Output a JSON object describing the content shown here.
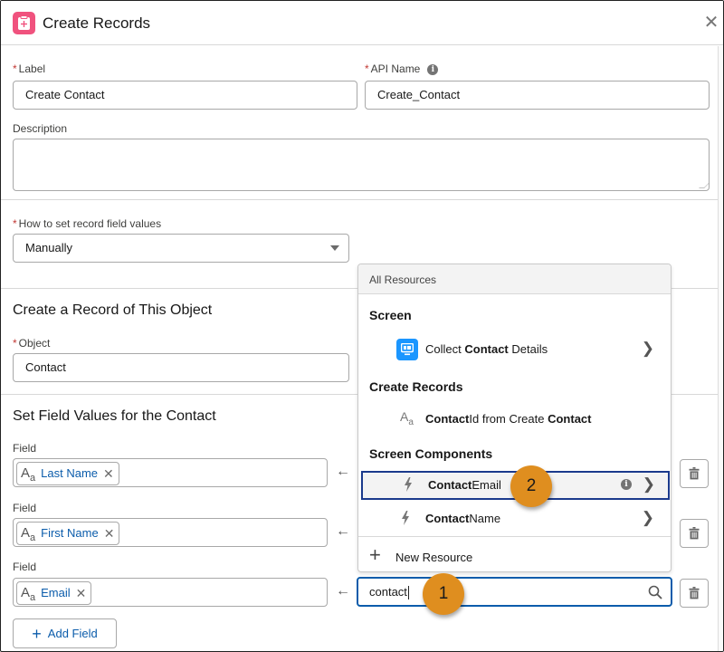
{
  "header": {
    "title": "Create Records",
    "icon": "create-record-icon",
    "icon_color": "#f0527e",
    "close_icon": "close-icon"
  },
  "general": {
    "label_field": {
      "label": "Label",
      "required": true,
      "value": "Create Contact"
    },
    "api_name_field": {
      "label": "API Name",
      "required": true,
      "value": "Create_Contact",
      "info_icon": "i"
    },
    "description_field": {
      "label": "Description",
      "value": ""
    }
  },
  "field_values_mode": {
    "label": "How to set record field values",
    "required": true,
    "selected": "Manually"
  },
  "object_section": {
    "title": "Create a Record of This Object",
    "object_field": {
      "label": "Object",
      "required": true,
      "value": "Contact"
    }
  },
  "field_values_section": {
    "title": "Set Field Values for the Contact",
    "rows": [
      {
        "field_label": "Field",
        "field_value": "Last Name",
        "type_icon": "text-type-icon"
      },
      {
        "field_label": "Field",
        "field_value": "First Name",
        "type_icon": "text-type-icon"
      },
      {
        "field_label": "Field",
        "field_value": "Email",
        "type_icon": "text-type-icon"
      }
    ],
    "arrow": "←",
    "add_field_label": "Add Field"
  },
  "resource_picker": {
    "header": "All Resources",
    "groups": [
      {
        "name": "Screen",
        "items": [
          {
            "pre": "Collect ",
            "bold": "Contact",
            "post": " Details",
            "icon": "screen-icon",
            "has_children": true
          }
        ]
      },
      {
        "name": "Create Records",
        "items": [
          {
            "pre": "",
            "bold": "Contact",
            "post": "Id from Create ",
            "bold2": "Contact",
            "icon": "text-type-icon",
            "has_children": false
          }
        ]
      },
      {
        "name": "Screen Components",
        "items": [
          {
            "pre": "",
            "bold": "Contact",
            "post": "Email",
            "icon": "bolt-icon",
            "has_children": true,
            "highlighted": true,
            "has_info": true
          },
          {
            "pre": "",
            "bold": "Contact",
            "post": "Name",
            "icon": "bolt-icon",
            "has_children": true
          }
        ]
      }
    ],
    "new_resource_label": "New Resource",
    "search_value": "contact"
  },
  "callouts": [
    {
      "number": "1",
      "color": "#df8e1f"
    },
    {
      "number": "2",
      "color": "#df8e1f"
    }
  ],
  "glyphs": {
    "aa_big": "A",
    "aa_small": "a",
    "remove": "✕",
    "chevron": "〉",
    "plus": "+",
    "close": "✕"
  }
}
